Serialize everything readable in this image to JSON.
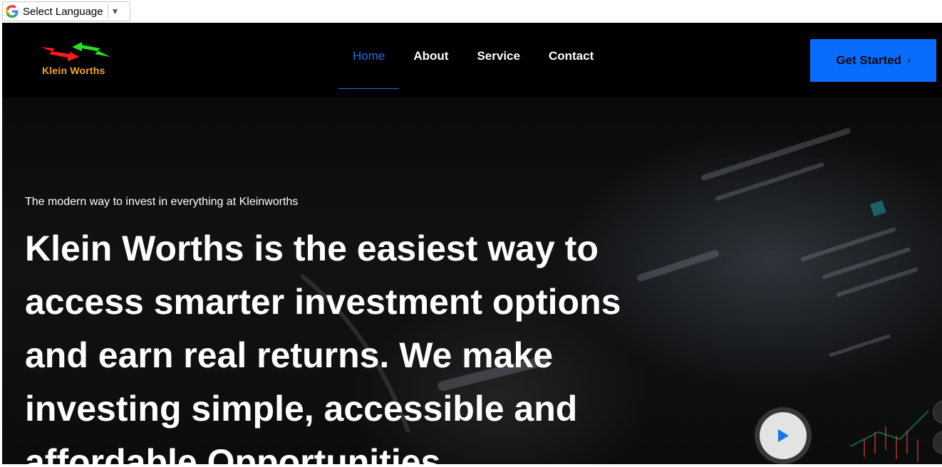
{
  "translate": {
    "label": "Select Language",
    "arrow": "▼",
    "icon": "google-g-icon"
  },
  "header": {
    "logo_text": "Klein Worths",
    "nav": [
      {
        "label": "Home",
        "active": true
      },
      {
        "label": "About",
        "active": false
      },
      {
        "label": "Service",
        "active": false
      },
      {
        "label": "Contact",
        "active": false
      }
    ],
    "cta_label": "Get Started",
    "cta_icon": "›"
  },
  "hero": {
    "tagline": "The modern way to invest in everything at Kleinworths",
    "headline": "Klein Worths is the easiest way to access smarter investment options and earn real returns. We make investing simple, accessible and affordable Opportunities"
  },
  "colors": {
    "accent": "#0a6cff",
    "nav_active": "#1a73e8",
    "logo_text": "#f5a623",
    "background": "#000000"
  }
}
